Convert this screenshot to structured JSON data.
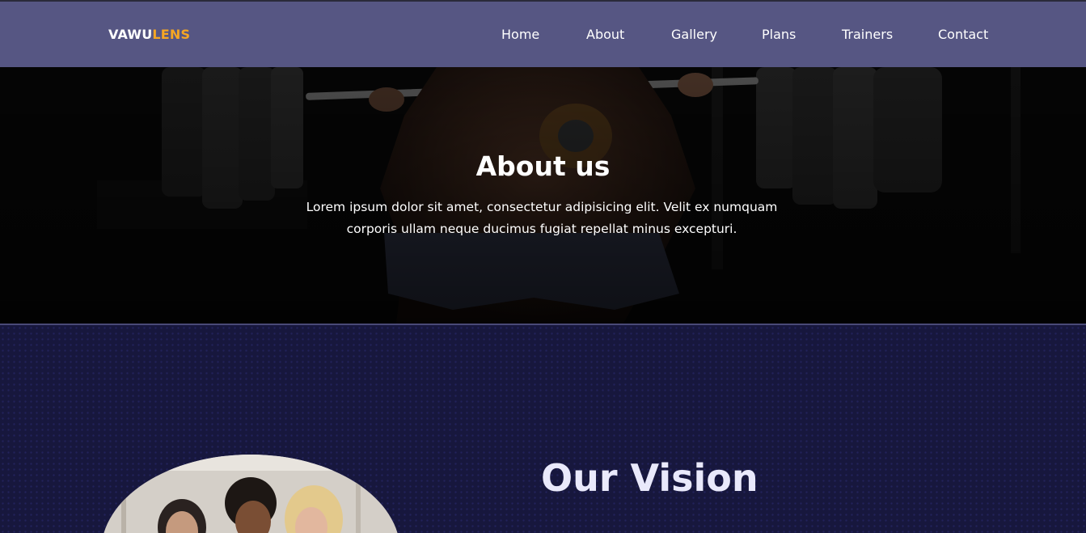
{
  "brand": {
    "part1": "VAWU",
    "part2": "LENS",
    "accent_color": "#f5a623"
  },
  "nav": {
    "items": [
      {
        "label": "Home"
      },
      {
        "label": "About"
      },
      {
        "label": "Gallery"
      },
      {
        "label": "Plans"
      },
      {
        "label": "Trainers"
      },
      {
        "label": "Contact"
      }
    ]
  },
  "hero": {
    "title": "About us",
    "text": "Lorem ipsum dolor sit amet, consectetur adipisicing elit. Velit ex numquam corporis ullam neque ducimus fugiat repellat minus excepturi."
  },
  "vision": {
    "title": "Our Vision"
  },
  "colors": {
    "navbar": "#565683",
    "section_bg": "#17173d",
    "heading_text": "#e9e9fb"
  }
}
